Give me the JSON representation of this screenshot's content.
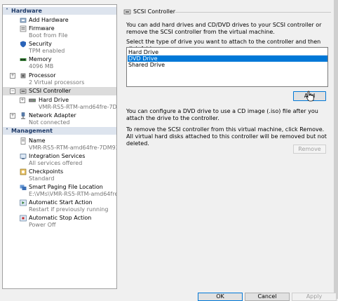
{
  "left": {
    "hardware_header": "Hardware",
    "management_header": "Management",
    "items": {
      "add_hardware": {
        "label": "Add Hardware"
      },
      "firmware": {
        "label": "Firmware",
        "sub": "Boot from File"
      },
      "security": {
        "label": "Security",
        "sub": "TPM enabled"
      },
      "memory": {
        "label": "Memory",
        "sub": "4096 MB"
      },
      "processor": {
        "label": "Processor",
        "sub": "2 Virtual processors"
      },
      "scsi": {
        "label": "SCSI Controller"
      },
      "hard_drive": {
        "label": "Hard Drive",
        "sub": "VMR-RS5-RTM-amd64fre-7DM..."
      },
      "network": {
        "label": "Network Adapter",
        "sub": "Not connected"
      },
      "name": {
        "label": "Name",
        "sub": "VMR-RS5-RTM-amd64fre-7DM93"
      },
      "integration": {
        "label": "Integration Services",
        "sub": "All services offered"
      },
      "checkpoints": {
        "label": "Checkpoints",
        "sub": "Standard"
      },
      "paging": {
        "label": "Smart Paging File Location",
        "sub": "E:\\VMs\\VMR-RS5-RTM-amd64fre-7..."
      },
      "autostart": {
        "label": "Automatic Start Action",
        "sub": "Restart if previously running"
      },
      "autostop": {
        "label": "Automatic Stop Action",
        "sub": "Power Off"
      }
    }
  },
  "right": {
    "title": "SCSI Controller",
    "intro": "You can add hard drives and CD/DVD drives to your SCSI controller or remove the SCSI controller from the virtual machine.",
    "select_prompt": "Select the type of drive you want to attach to the controller and then click Add.",
    "drive_types": [
      "Hard Drive",
      "DVD Drive",
      "Shared Drive"
    ],
    "selected_index": 1,
    "add_label": "Add",
    "dvd_note": "You can configure a DVD drive to use a CD image (.iso) file after you attach the drive to the controller.",
    "remove_note": "To remove the SCSI controller from this virtual machine, click Remove. All virtual hard disks attached to this controller will be removed but not deleted.",
    "remove_label": "Remove"
  },
  "buttons": {
    "ok": "OK",
    "cancel": "Cancel",
    "apply": "Apply"
  },
  "colors": {
    "accent": "#0078d7",
    "section_header_bg": "#dde4ee",
    "section_header_text": "#1f3b69"
  }
}
